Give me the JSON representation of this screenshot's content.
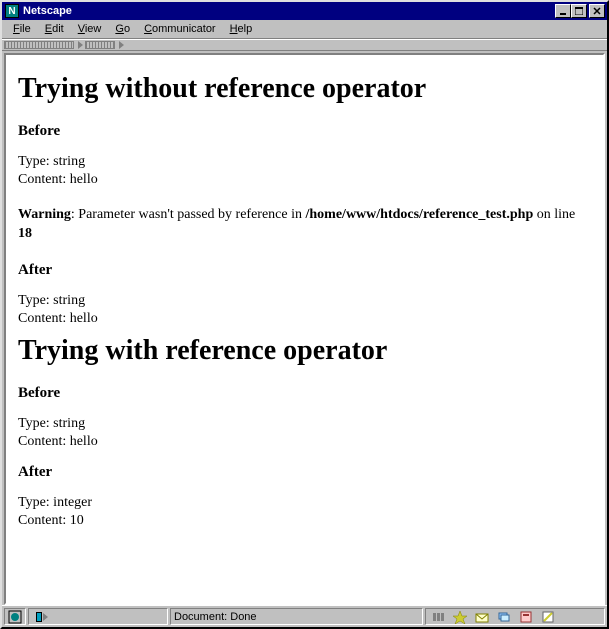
{
  "window": {
    "title": "Netscape"
  },
  "menu": {
    "items": [
      {
        "label": "File",
        "accel": "F"
      },
      {
        "label": "Edit",
        "accel": "E"
      },
      {
        "label": "View",
        "accel": "V"
      },
      {
        "label": "Go",
        "accel": "G"
      },
      {
        "label": "Communicator",
        "accel": "C"
      },
      {
        "label": "Help",
        "accel": "H"
      }
    ]
  },
  "page": {
    "section1": {
      "heading": "Trying without reference operator",
      "before_label": "Before",
      "before_type": "Type: string",
      "before_content": "Content: hello",
      "warning_label": "Warning",
      "warning_text1": ": Parameter wasn't passed by reference in ",
      "warning_file": "/home/www/htdocs/reference_test.php",
      "warning_text2": " on line ",
      "warning_line": "18",
      "after_label": "After",
      "after_type": "Type: string",
      "after_content": "Content: hello"
    },
    "section2": {
      "heading": "Trying with reference operator",
      "before_label": "Before",
      "before_type": "Type: string",
      "before_content": "Content: hello",
      "after_label": "After",
      "after_type": "Type: integer",
      "after_content": "Content: 10"
    }
  },
  "statusbar": {
    "text": "Document: Done"
  }
}
